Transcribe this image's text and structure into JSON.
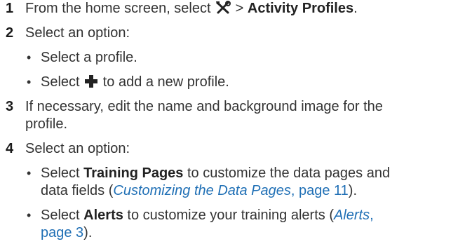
{
  "steps": [
    {
      "number": "1",
      "prefix": "From the home screen, select",
      "icon": "tools-icon",
      "sep": " > ",
      "bold": "Activity Profiles",
      "suffix": "."
    },
    {
      "number": "2",
      "text": "Select an option:",
      "bullets": [
        {
          "text": "Select a profile."
        },
        {
          "prefix": "Select",
          "icon": "plus-icon",
          "suffix": "to add a new profile."
        }
      ]
    },
    {
      "number": "3",
      "line1": "If necessary, edit the name and background image for the",
      "line2": "profile."
    },
    {
      "number": "4",
      "text": "Select an option:",
      "bullets": [
        {
          "prefix": "Select",
          "bold": "Training Pages",
          "line1_rest": "to customize the data pages and",
          "line2_prefix": "data fields (",
          "link_italic": "Customizing the Data Pages",
          "link_page": ", page 11",
          "line2_suffix": ")."
        },
        {
          "prefix": "Select",
          "bold": "Alerts",
          "line1_rest": "to customize your training alerts (",
          "link_italic": "Alerts",
          "link_comma": ",",
          "link_page": "page 3",
          "line2_suffix": ")."
        }
      ]
    }
  ],
  "colors": {
    "text": "#333333",
    "link": "#1f6fb5"
  }
}
